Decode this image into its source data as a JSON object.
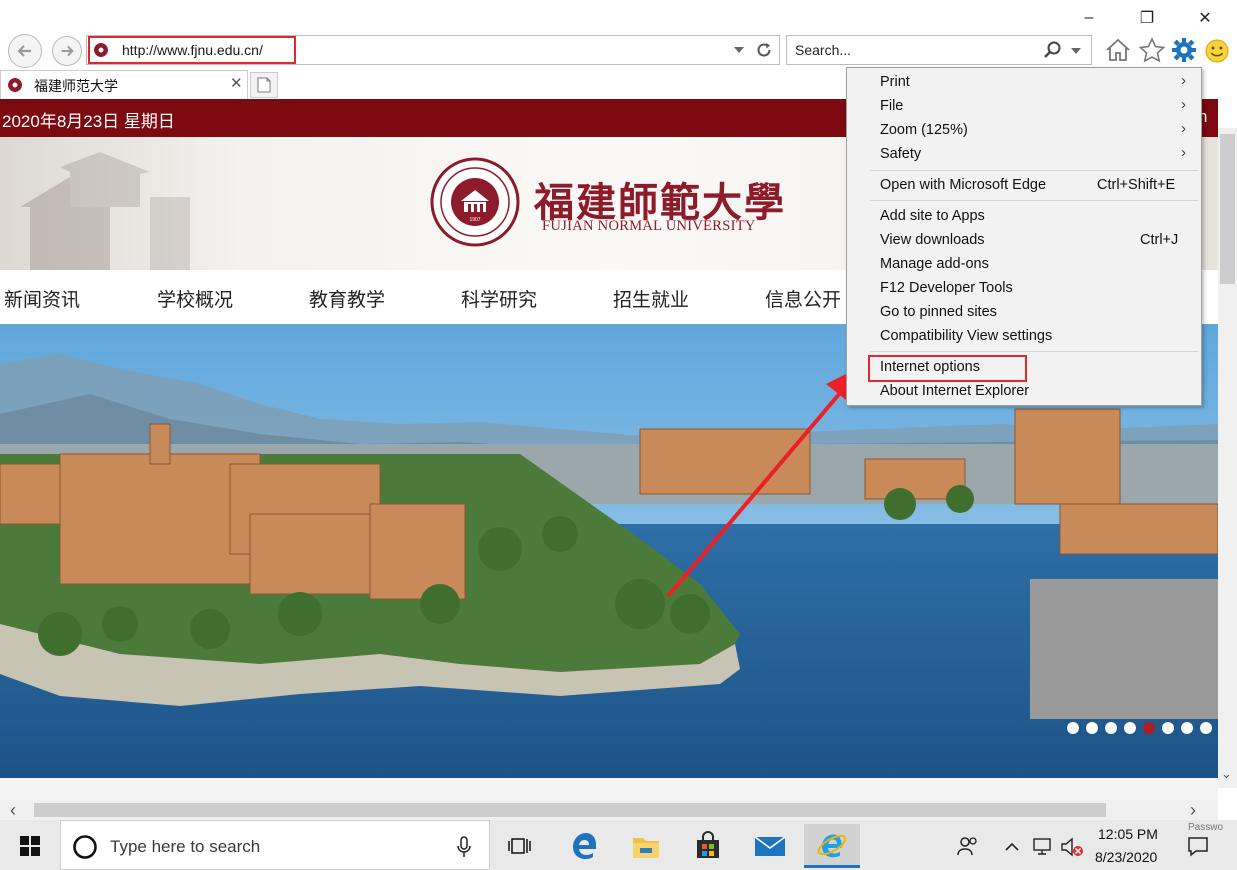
{
  "window": {
    "minimize_glyph": "–",
    "restore_glyph": "❐",
    "close_glyph": "✕"
  },
  "nav": {
    "url": "http://www.fjnu.edu.cn/",
    "search_placeholder": "Search...",
    "tab_title": "福建师范大学"
  },
  "page": {
    "date": "2020年8月23日 星期日",
    "english_link": "n",
    "logo_chinese": "福建師範大學",
    "logo_english": "FUJIAN NORMAL UNIVERSITY",
    "seal_year": "1907",
    "nav_items": [
      "新闻资讯",
      "学校概况",
      "教育教学",
      "科学研究",
      "招生就业",
      "信息公开"
    ],
    "slide_count": 8,
    "active_slide": 5
  },
  "menu": {
    "items": [
      {
        "label": "Print",
        "submenu": true
      },
      {
        "label": "File",
        "submenu": true
      },
      {
        "label": "Zoom (125%)",
        "submenu": true
      },
      {
        "label": "Safety",
        "submenu": true
      },
      {
        "label": "Open with Microsoft Edge",
        "shortcut": "Ctrl+Shift+E"
      },
      {
        "label": "Add site to Apps"
      },
      {
        "label": "View downloads",
        "shortcut": "Ctrl+J"
      },
      {
        "label": "Manage add-ons"
      },
      {
        "label": "F12 Developer Tools"
      },
      {
        "label": "Go to pinned sites"
      },
      {
        "label": "Compatibility View settings"
      },
      {
        "label": "Internet options",
        "highlighted": true
      },
      {
        "label": "About Internet Explorer"
      }
    ],
    "submenu_glyph": "›"
  },
  "taskbar": {
    "search_placeholder": "Type here to search",
    "time": "12:05 PM",
    "date": "8/23/2020",
    "overlay_text": "Passwo"
  },
  "colors": {
    "accent_red": "#e0282d",
    "school_red": "#7c0a10",
    "ie_blue": "#1e73be"
  },
  "icons": [
    "back-icon",
    "forward-icon",
    "dropdown-icon",
    "refresh-icon",
    "search-icon",
    "home-icon",
    "favorites-star-icon",
    "tools-gear-icon",
    "smiley-feedback-icon",
    "windows-start-icon",
    "cortana-circle-icon",
    "microphone-icon",
    "task-view-icon",
    "edge-icon",
    "file-explorer-icon",
    "store-icon",
    "mail-icon",
    "internet-explorer-icon",
    "people-icon",
    "chevron-up-icon",
    "network-icon",
    "volume-muted-icon",
    "notification-icon"
  ]
}
